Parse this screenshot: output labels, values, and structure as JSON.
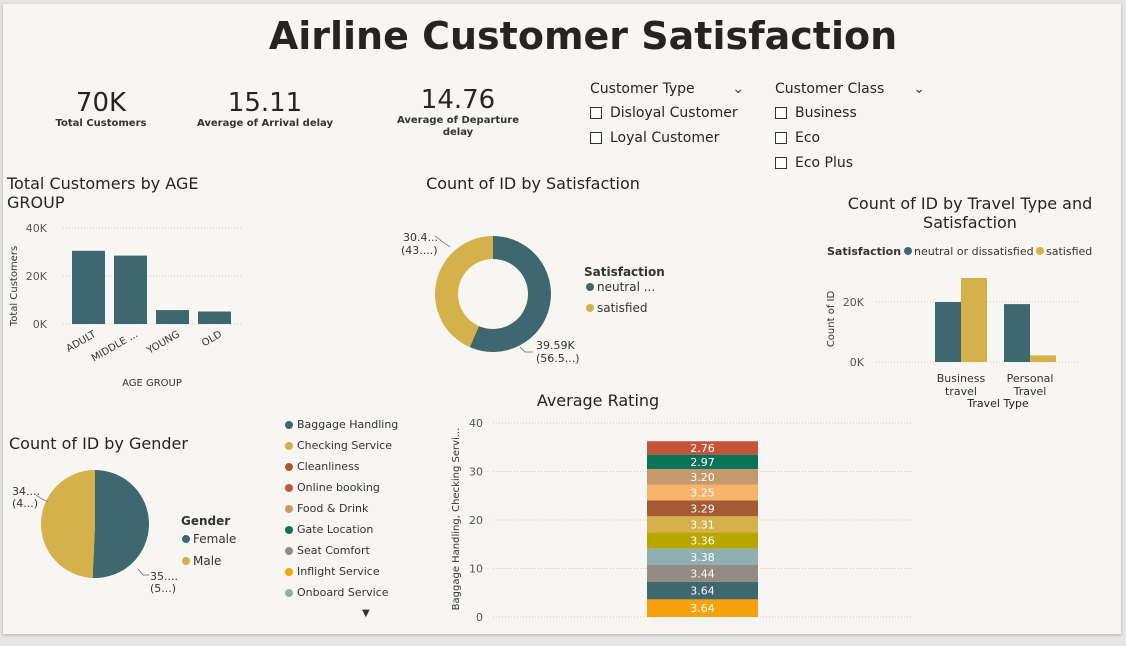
{
  "dashboard": {
    "title": "Airline Customer Satisfaction"
  },
  "kpis": [
    {
      "value": "70K",
      "label": "Total Customers"
    },
    {
      "value": "15.11",
      "label": "Average of Arrival delay"
    },
    {
      "value": "14.76",
      "label": "Average of Departure delay"
    }
  ],
  "slicers": {
    "customer_type": {
      "title": "Customer Type",
      "items": [
        "Disloyal Customer",
        "Loyal Customer"
      ]
    },
    "customer_class": {
      "title": "Customer Class",
      "items": [
        "Business",
        "Eco",
        "Eco Plus"
      ]
    }
  },
  "colors": {
    "teal": "#3f6770",
    "gold": "#d4b14a"
  },
  "chart_data": [
    {
      "id": "age",
      "type": "bar",
      "title": "Total Customers by AGE GROUP",
      "xlabel": "AGE GROUP",
      "ylabel": "Total Customers",
      "categories": [
        "ADULT",
        "MIDDLE ...",
        "YOUNG",
        "OLD"
      ],
      "values": [
        30500,
        28500,
        5800,
        5200
      ],
      "ylim": [
        0,
        40000
      ],
      "yticks": [
        "0K",
        "20K",
        "40K"
      ],
      "color": "#3f6770"
    },
    {
      "id": "satisfaction",
      "type": "pie",
      "title": "Count of ID by Satisfaction",
      "legend_title": "Satisfaction",
      "slices": [
        {
          "name": "neutral ...",
          "value": 39590,
          "label1": "39.59K",
          "label2": "(56.5...)",
          "color": "#3f6770"
        },
        {
          "name": "satisfied",
          "value": 30400,
          "label1": "30.4...",
          "label2": "(43....)",
          "color": "#d4b14a"
        }
      ]
    },
    {
      "id": "travel",
      "type": "bar",
      "title": "Count of ID by Travel Type and Satisfaction",
      "xlabel": "Travel Type",
      "ylabel": "Count of ID",
      "legend_title": "Satisfaction",
      "categories": [
        "Business travel",
        "Personal Travel"
      ],
      "series": [
        {
          "name": "neutral or dissatisfied",
          "values": [
            20000,
            19300
          ],
          "color": "#3f6770"
        },
        {
          "name": "satisfied",
          "values": [
            28000,
            2200
          ],
          "color": "#d4b14a"
        }
      ],
      "yticks": [
        "0K",
        "20K"
      ],
      "ylim": [
        0,
        30000
      ]
    },
    {
      "id": "gender",
      "type": "pie",
      "title": "Count of ID by Gender",
      "legend_title": "Gender",
      "slices": [
        {
          "name": "Female",
          "value": 35500,
          "label1": "35....",
          "label2": "(5...)",
          "color": "#3f6770"
        },
        {
          "name": "Male",
          "value": 34500,
          "label1": "34....",
          "label2": "(4...)",
          "color": "#d4b14a"
        }
      ]
    },
    {
      "id": "rating",
      "type": "bar",
      "title": "Average Rating",
      "ylabel": "Baggage Handling, Checking Servi...",
      "ylim": [
        0,
        40
      ],
      "yticks": [
        "0",
        "10",
        "20",
        "30",
        "40"
      ],
      "legend": [
        {
          "name": "Baggage Handling",
          "color": "#3f6770"
        },
        {
          "name": "Checking Service",
          "color": "#d4b14a"
        },
        {
          "name": "Cleanliness",
          "color": "#a65a34"
        },
        {
          "name": "Online booking",
          "color": "#c5553a"
        },
        {
          "name": "Food & Drink",
          "color": "#c49a6c"
        },
        {
          "name": "Gate Location",
          "color": "#0b7358"
        },
        {
          "name": "Seat Comfort",
          "color": "#958b82"
        },
        {
          "name": "Inflight Service",
          "color": "#f5a20c"
        },
        {
          "name": "Onboard Service",
          "color": "#8fb0b1"
        }
      ],
      "stack_bottom_to_top": [
        {
          "value": 3.64,
          "label": "3.64",
          "color": "#f5a20c"
        },
        {
          "value": 3.64,
          "label": "3.64",
          "color": "#3f6770"
        },
        {
          "value": 3.44,
          "label": "3.44",
          "color": "#958b82"
        },
        {
          "value": 3.38,
          "label": "3.38",
          "color": "#8fb0b1"
        },
        {
          "value": 3.36,
          "label": "3.36",
          "color": "#b8a600"
        },
        {
          "value": 3.31,
          "label": "3.31",
          "color": "#d4b14a"
        },
        {
          "value": 3.29,
          "label": "3.29",
          "color": "#a65a34"
        },
        {
          "value": 3.25,
          "label": "3.25",
          "color": "#f6b36a"
        },
        {
          "value": 3.2,
          "label": "3.20",
          "color": "#c49a6c"
        },
        {
          "value": 2.97,
          "label": "2.97",
          "color": "#0b7358"
        },
        {
          "value": 2.76,
          "label": "2.76",
          "color": "#c5553a"
        }
      ]
    }
  ]
}
